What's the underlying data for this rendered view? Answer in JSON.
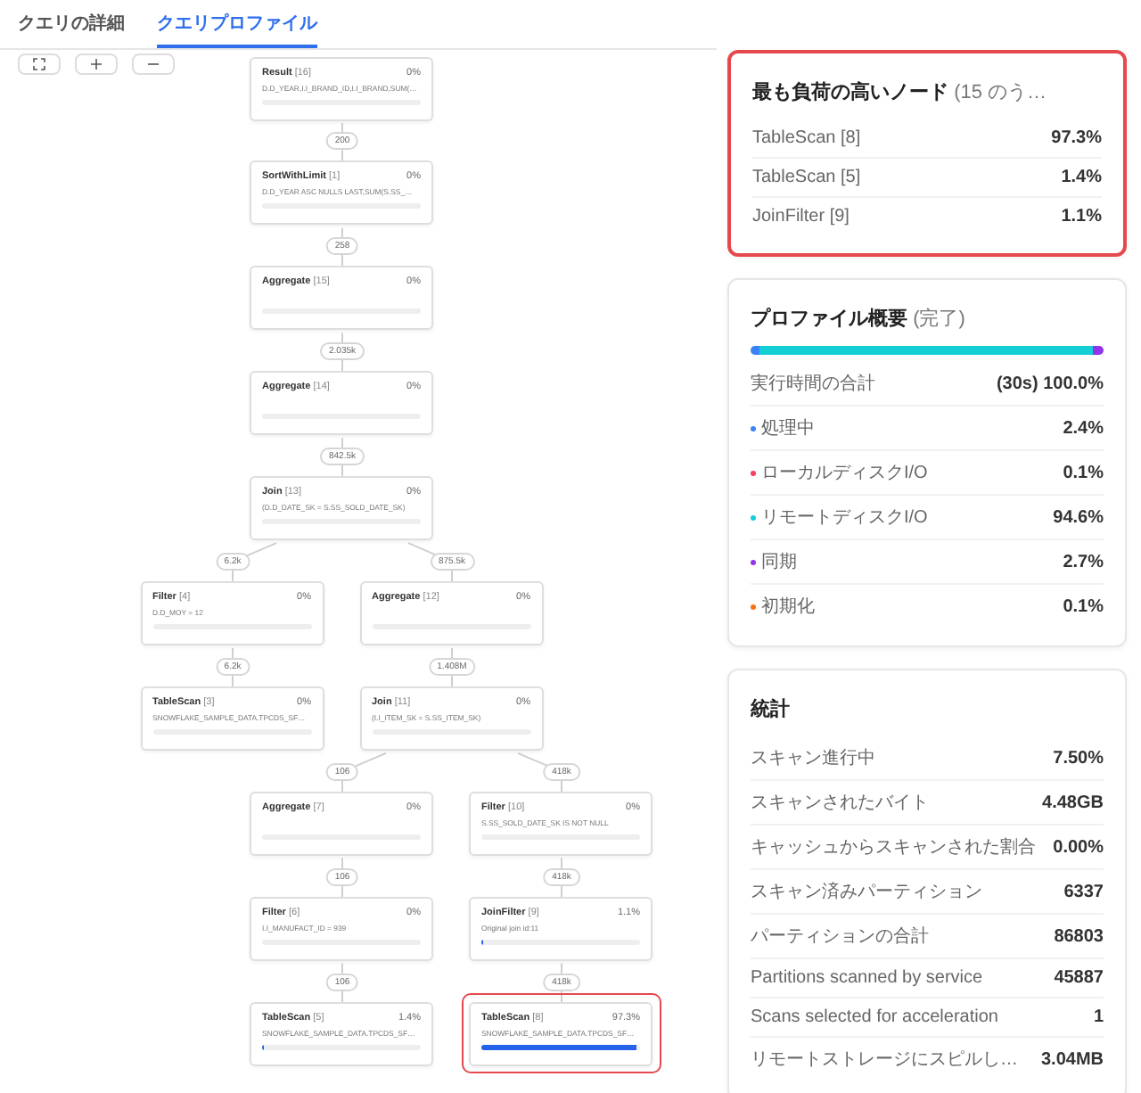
{
  "tabs": [
    {
      "label": "クエリの詳細",
      "selected": false
    },
    {
      "label": "クエリプロファイル",
      "selected": true
    }
  ],
  "toolbar": [
    {
      "kind": "fit"
    },
    {
      "kind": "zoom_in"
    },
    {
      "kind": "zoom_out"
    }
  ],
  "plan": {
    "name": "Result",
    "number": "[16]",
    "percent": "0%",
    "detail": "D.D_YEAR,I.I_BRAND_ID,I.I_BRAND,SUM(…",
    "level": 0,
    "highlighted": false,
    "children": [
      {
        "name": "SortWithLimit",
        "number": "[1]",
        "percent": "0%",
        "detail": "D.D_YEAR ASC NULLS LAST,SUM(S.SS_…",
        "level": 0,
        "highlighted": false,
        "rows": "200",
        "children": [
          {
            "name": "Aggregate",
            "number": "[15]",
            "percent": "0%",
            "level": 0,
            "highlighted": false,
            "rows": "258",
            "children": [
              {
                "name": "Aggregate",
                "number": "[14]",
                "percent": "0%",
                "level": 0,
                "highlighted": false,
                "rows": "2.035k",
                "children": [
                  {
                    "name": "Join",
                    "number": "[13]",
                    "percent": "0%",
                    "detail": "(D.D_DATE_SK = S.SS_SOLD_DATE_SK)",
                    "level": 0,
                    "highlighted": false,
                    "rows": "842.5k",
                    "children": [
                      {
                        "name": "Filter",
                        "number": "[4]",
                        "percent": "0%",
                        "detail": "D.D_MOY = 12",
                        "level": 0,
                        "highlighted": false,
                        "rows": "6.2k",
                        "children": [
                          {
                            "name": "TableScan",
                            "number": "[3]",
                            "percent": "0%",
                            "detail": "SNOWFLAKE_SAMPLE_DATA.TPCDS_SF…",
                            "level": 0,
                            "highlighted": false,
                            "rows": "6.2k"
                          }
                        ]
                      },
                      {
                        "name": "Aggregate",
                        "number": "[12]",
                        "percent": "0%",
                        "level": 0,
                        "highlighted": false,
                        "rows": "875.5k",
                        "children": [
                          {
                            "name": "Join",
                            "number": "[11]",
                            "percent": "0%",
                            "detail": "(I.I_ITEM_SK = S.SS_ITEM_SK)",
                            "level": 0,
                            "highlighted": false,
                            "rows": "1.408M",
                            "children": [
                              {
                                "name": "Aggregate",
                                "number": "[7]",
                                "percent": "0%",
                                "level": 0,
                                "highlighted": false,
                                "rows": "106",
                                "children": [
                                  {
                                    "name": "Filter",
                                    "number": "[6]",
                                    "percent": "0%",
                                    "detail": "I.I_MANUFACT_ID = 939",
                                    "level": 0,
                                    "highlighted": false,
                                    "rows": "106",
                                    "children": [
                                      {
                                        "name": "TableScan",
                                        "number": "[5]",
                                        "percent": "1.4%",
                                        "detail": "SNOWFLAKE_SAMPLE_DATA.TPCDS_SF…",
                                        "level": 0.014,
                                        "highlighted": false,
                                        "rows": "106"
                                      }
                                    ]
                                  }
                                ]
                              },
                              {
                                "name": "Filter",
                                "number": "[10]",
                                "percent": "0%",
                                "detail": "S.SS_SOLD_DATE_SK IS NOT NULL",
                                "level": 0,
                                "highlighted": false,
                                "rows": "418k",
                                "children": [
                                  {
                                    "name": "JoinFilter",
                                    "number": "[9]",
                                    "percent": "1.1%",
                                    "detail": "Original join id:11",
                                    "level": 0.011,
                                    "highlighted": false,
                                    "rows": "418k",
                                    "children": [
                                      {
                                        "name": "TableScan",
                                        "number": "[8]",
                                        "percent": "97.3%",
                                        "detail": "SNOWFLAKE_SAMPLE_DATA.TPCDS_SF…",
                                        "level": 0.973,
                                        "highlighted": true,
                                        "rows": "418k"
                                      }
                                    ]
                                  }
                                ]
                              }
                            ]
                          }
                        ]
                      }
                    ]
                  }
                ]
              }
            ]
          }
        ]
      }
    ]
  },
  "top_nodes": {
    "title": "最も負荷の高いノード",
    "title_suffix": "(15 のう…",
    "highlighted": true,
    "rows": [
      {
        "label": "TableScan [8]",
        "value": "97.3%"
      },
      {
        "label": "TableScan [5]",
        "value": "1.4%"
      },
      {
        "label": "JoinFilter [9]",
        "value": "1.1%"
      }
    ]
  },
  "overview": {
    "title": "プロファイル概要",
    "title_suffix": "(完了)",
    "total": {
      "label": "実行時間の合計",
      "value": "(30s) 100.0%"
    },
    "items": [
      {
        "label": "処理中",
        "value": "2.4%",
        "color": "#3b82f6",
        "level": 0.024
      },
      {
        "label": "ローカルディスクI/O",
        "value": "0.1%",
        "color": "#f43f5e",
        "level": 0.001
      },
      {
        "label": "リモートディスクI/O",
        "value": "94.6%",
        "color": "#14cfd6",
        "level": 0.946
      },
      {
        "label": "同期",
        "value": "2.7%",
        "color": "#9333ea",
        "level": 0.027
      },
      {
        "label": "初期化",
        "value": "0.1%",
        "color": "#f97316",
        "level": 0.001
      }
    ]
  },
  "statistics": {
    "title": "統計",
    "rows": [
      {
        "label": "スキャン進行中",
        "value": "7.50%"
      },
      {
        "label": "スキャンされたバイト",
        "value": "4.48GB"
      },
      {
        "label": "キャッシュからスキャンされた割合",
        "value": "0.00%"
      },
      {
        "label": "スキャン済みパーティション",
        "value": "6337"
      },
      {
        "label": "パーティションの合計",
        "value": "86803"
      },
      {
        "label": "Partitions scanned by service",
        "value": "45887"
      },
      {
        "label": "Scans selected for acceleration",
        "value": "1"
      },
      {
        "label": "リモートストレージにスピルし…",
        "value": "3.04MB"
      }
    ]
  }
}
